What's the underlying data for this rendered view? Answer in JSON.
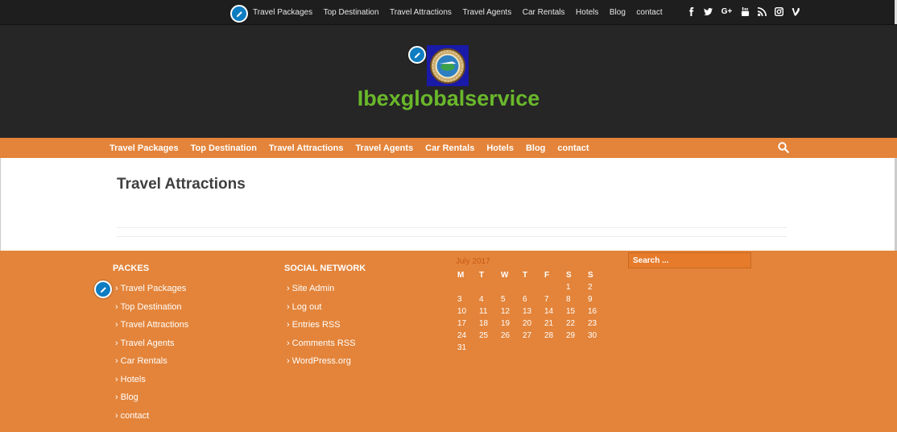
{
  "topbar": {
    "nav": [
      "Travel Packages",
      "Top Destination",
      "Travel Attractions",
      "Travel Agents",
      "Car Rentals",
      "Hotels",
      "Blog",
      "contact"
    ],
    "social_icons": [
      "facebook-icon",
      "twitter-icon",
      "google-plus-icon",
      "youtube-icon",
      "rss-icon",
      "instagram-icon",
      "vine-icon"
    ]
  },
  "header": {
    "site_title": "Ibexglobalservice"
  },
  "mainnav": {
    "items": [
      "Travel Packages",
      "Top Destination",
      "Travel Attractions",
      "Travel Agents",
      "Car Rentals",
      "Hotels",
      "Blog",
      "contact"
    ]
  },
  "content": {
    "page_title": "Travel Attractions"
  },
  "footer": {
    "packes": {
      "title": "PACKES",
      "items": [
        "Travel Packages",
        "Top Destination",
        "Travel Attractions",
        "Travel Agents",
        "Car Rentals",
        "Hotels",
        "Blog",
        "contact"
      ]
    },
    "social": {
      "title": "SOCIAL NETWORK",
      "items": [
        "Site Admin",
        "Log out",
        "Entries RSS",
        "Comments RSS",
        "WordPress.org"
      ]
    },
    "calendar": {
      "caption": "July 2017",
      "days": [
        "M",
        "T",
        "W",
        "T",
        "F",
        "S",
        "S"
      ],
      "weeks": [
        [
          "",
          "",
          "",
          "",
          "",
          "1",
          "2"
        ],
        [
          "3",
          "4",
          "5",
          "6",
          "7",
          "8",
          "9"
        ],
        [
          "10",
          "11",
          "12",
          "13",
          "14",
          "15",
          "16"
        ],
        [
          "17",
          "18",
          "19",
          "20",
          "21",
          "22",
          "23"
        ],
        [
          "24",
          "25",
          "26",
          "27",
          "28",
          "29",
          "30"
        ],
        [
          "31",
          "",
          "",
          "",
          "",
          "",
          ""
        ]
      ]
    },
    "search_placeholder": "Search ..."
  },
  "colors": {
    "orange": "#e3843a",
    "dark": "#262626",
    "title_green": "#6ab82b",
    "edit_blue": "#0e7cc1"
  }
}
